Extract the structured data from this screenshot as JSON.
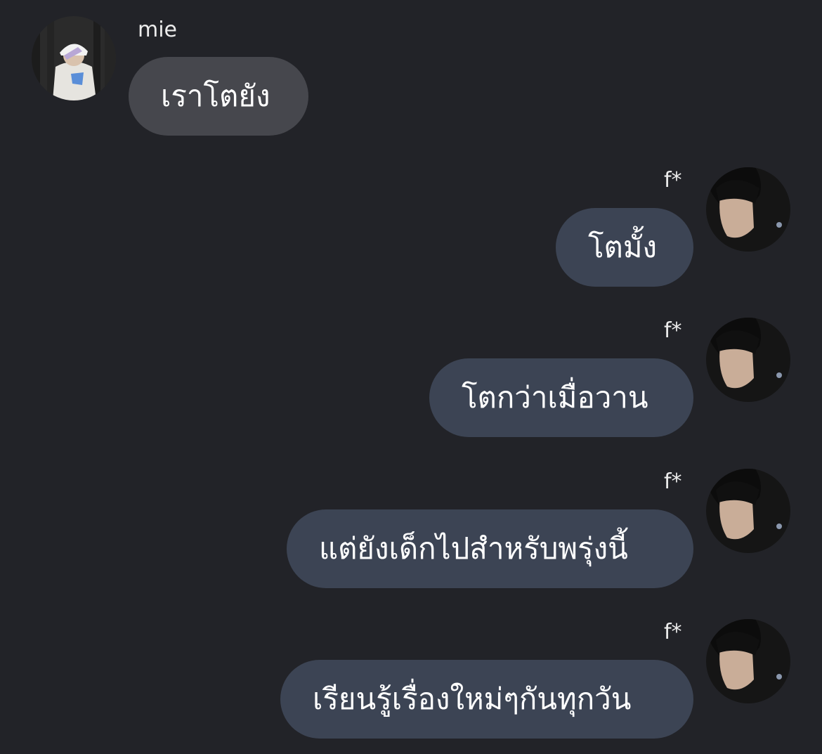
{
  "messages": [
    {
      "sender": "mie",
      "direction": "incoming",
      "text": "เราโตยัง"
    },
    {
      "sender": "f*",
      "direction": "outgoing",
      "text": "โตมั้ง"
    },
    {
      "sender": "f*",
      "direction": "outgoing",
      "text": "โตกว่าเมื่อวาน"
    },
    {
      "sender": "f*",
      "direction": "outgoing",
      "text": "แต่ยังเด็กไปสำหรับพรุ่งนี้"
    },
    {
      "sender": "f*",
      "direction": "outgoing",
      "text": "เรียนรู้เรื่องใหม่ๆกันทุกวัน"
    }
  ],
  "theme": {
    "background": "#222328",
    "incoming_bubble": "#46474d",
    "outgoing_bubble": "#3c4454",
    "text": "#ffffff"
  }
}
